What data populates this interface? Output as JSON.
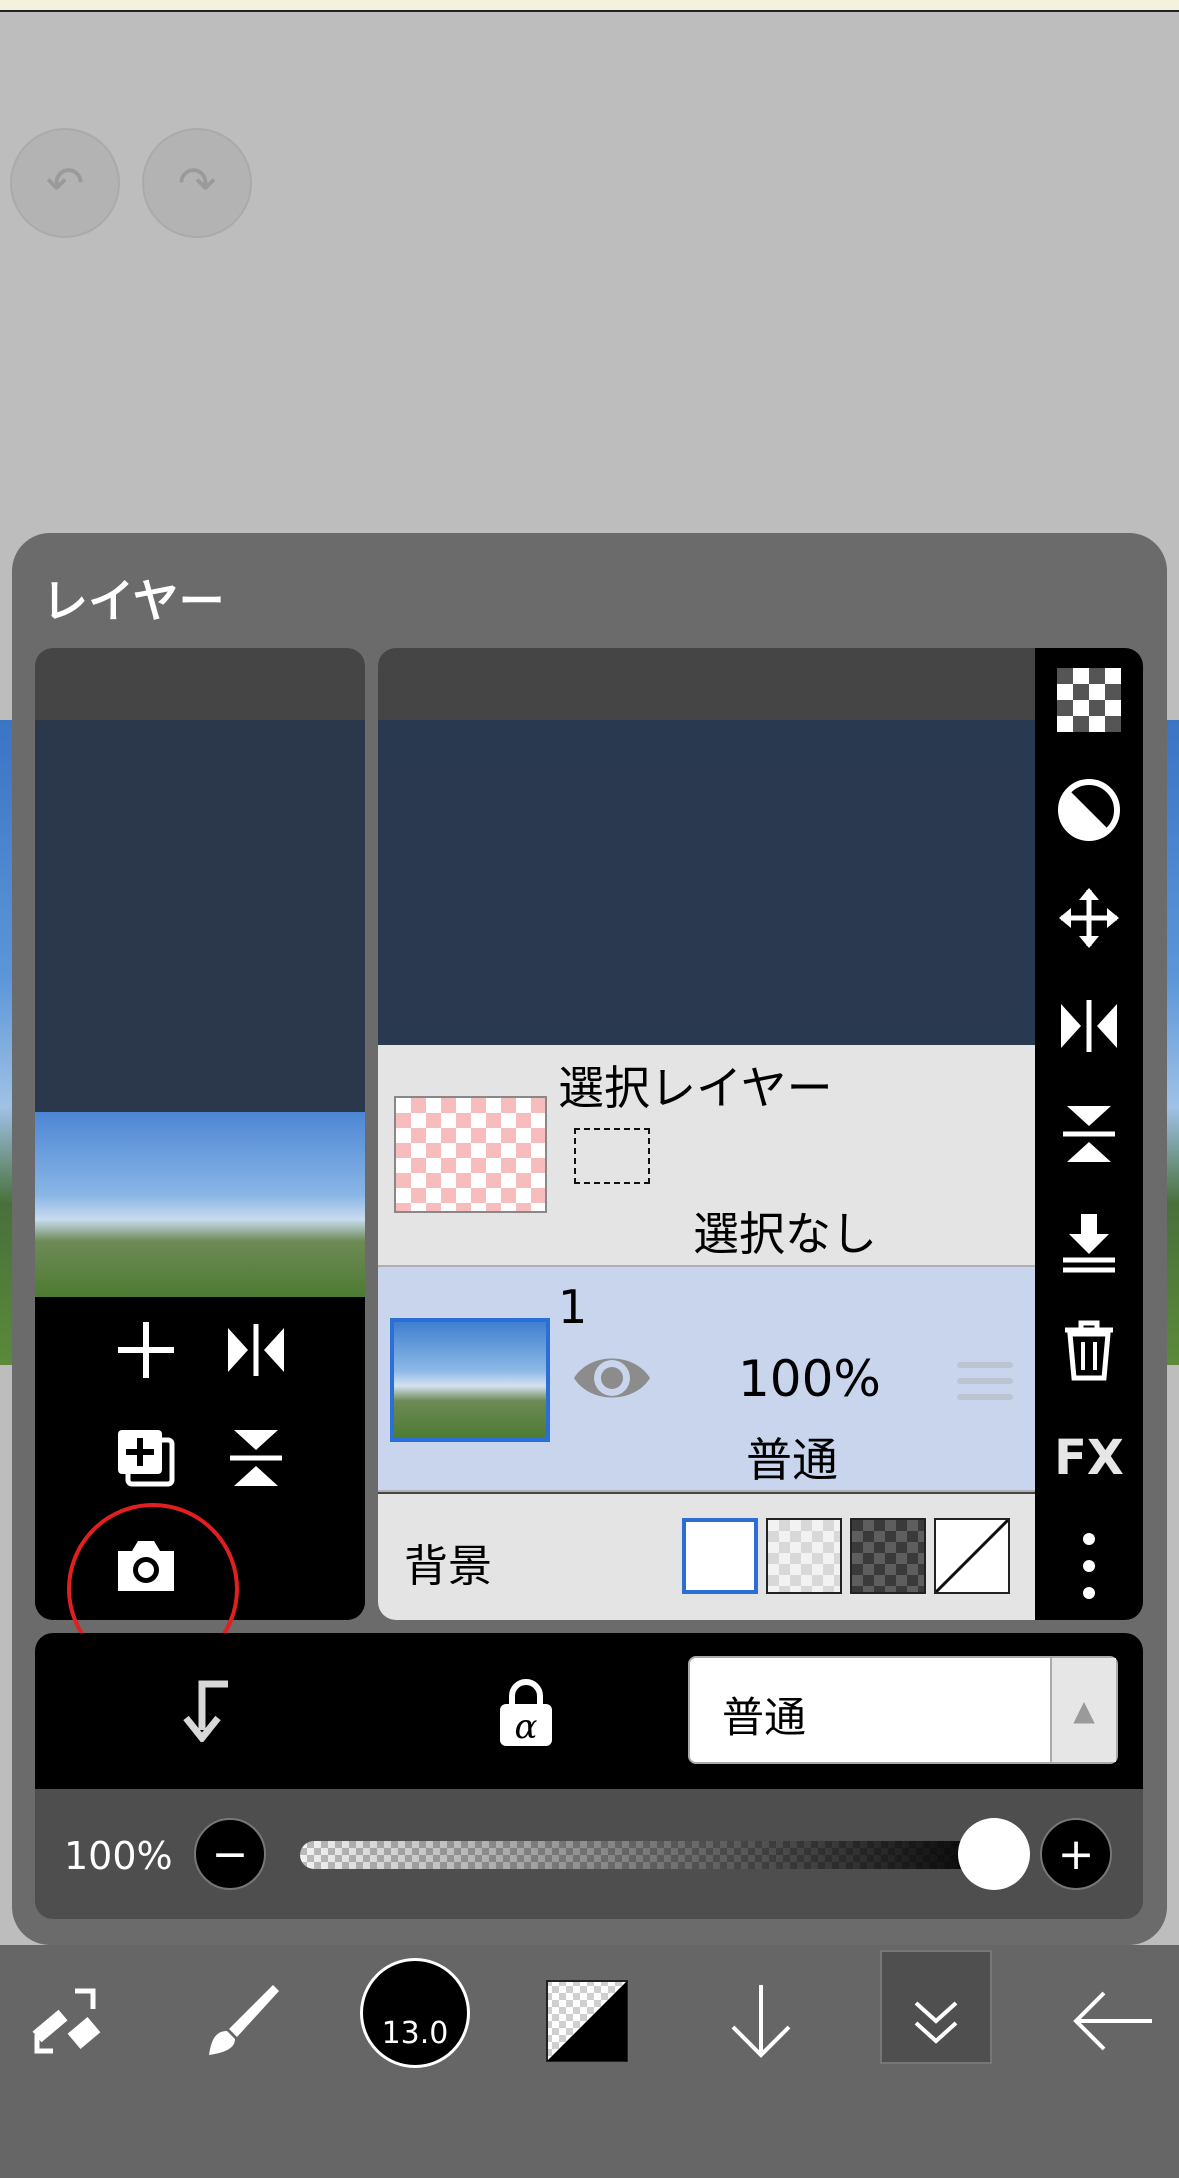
{
  "panel": {
    "title": "レイヤー"
  },
  "layers": {
    "selection_layer": {
      "name": "選択レイヤー",
      "status": "選択なし"
    },
    "layer1": {
      "number": "1",
      "opacity": "100%",
      "blend_mode": "普通",
      "visible": true
    }
  },
  "background": {
    "label": "背景",
    "options": [
      "white",
      "light-checker",
      "dark-checker",
      "none"
    ],
    "selected": "white"
  },
  "blend_select": {
    "value": "普通"
  },
  "opacity": {
    "label": "100%",
    "value": 1.0,
    "minus": "−",
    "plus": "+"
  },
  "toolbar": {
    "brush_size": "13.0"
  },
  "annotation": {
    "circle_color": "#e02020"
  }
}
